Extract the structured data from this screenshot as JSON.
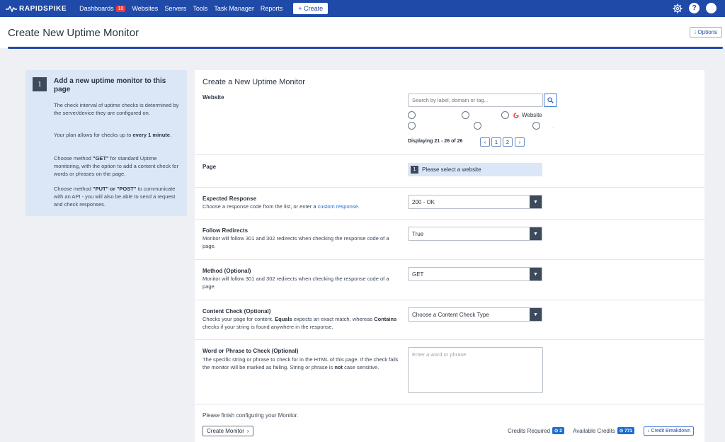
{
  "nav": {
    "brand": "RAPIDSPIKE",
    "items": [
      {
        "label": "Dashboards",
        "badge": "10"
      },
      {
        "label": "Websites"
      },
      {
        "label": "Servers"
      },
      {
        "label": "Tools"
      },
      {
        "label": "Task Manager"
      },
      {
        "label": "Reports"
      }
    ],
    "create_label": "+ Create",
    "help_glyph": "?"
  },
  "header": {
    "title": "Create New Uptime Monitor",
    "options_label": "⁝ Options"
  },
  "info": {
    "number": "1",
    "title": "Add a new uptime monitor to this page",
    "p1": "The check interval of uptime checks is determined by the server/device they are configured on.",
    "p2_pre": "Your plan allows for checks up to ",
    "p2_bold": "every 1 minute",
    "p2_post": ".",
    "p3_pre": "Choose method ",
    "p3_bold": "\"GET\"",
    "p3_post": " for standard Uptime monitoring, with the option to add a content check for words or phrases on the page.",
    "p4_pre": "Choose method ",
    "p4_bold": "\"PUT\" or \"POST\"",
    "p4_post": " to communicate with an API - you will also be able to send a request and check responses."
  },
  "form": {
    "title": "Create a New Uptime Monitor",
    "website": {
      "label": "Website",
      "search_placeholder": "Search by label, domain or tag...",
      "radio_option_label": "Website",
      "pager_text": "Displaying 21 - 26 of 26",
      "pages": [
        "1",
        "2"
      ],
      "prev_glyph": "‹",
      "next_glyph": "›"
    },
    "page": {
      "label": "Page",
      "notice_number": "1",
      "notice": "Please select a website"
    },
    "expected_response": {
      "label": "Expected Response",
      "help_pre": "Choose a response code from the list, or enter a ",
      "help_link": "custom response",
      "help_post": ".",
      "value": "200 - OK"
    },
    "follow_redirects": {
      "label": "Follow Redirects",
      "help": "Monitor will follow 301 and 302 redirects when checking the response code of a page.",
      "value": "True"
    },
    "method": {
      "label": "Method (Optional)",
      "help": "Monitor will follow 301 and 302 redirects when checking the response code of a page.",
      "value": "GET"
    },
    "content_check": {
      "label": "Content Check (Optional)",
      "help_pre": "Checks your page for content. ",
      "help_b1": "Equals",
      "help_mid": " expects an exact match, whereas ",
      "help_b2": "Contains",
      "help_post": " checks if your string is found anywhere in the response.",
      "value": "Choose a Content Check Type"
    },
    "phrase": {
      "label": "Word or Phrase to Check (Optional)",
      "help_pre": "The specific string or phrase to check for in the HTML of this page. If the check fails the monitor will be marked as failing. String or phrase is ",
      "help_bold": "not",
      "help_post": " case sensitive.",
      "placeholder": "Enter a word or phrase"
    },
    "footer": {
      "note": "Please finish configuring your Monitor.",
      "create_label": "Create Monitor",
      "credits_required_label": "Credits Required",
      "credits_required": "2",
      "available_label": "Available Credits",
      "available": "771",
      "breakdown_label": "↓ Credit Breakdown"
    }
  },
  "colors": {
    "nav_bg": "#1f4aa8",
    "info_bg": "#dbe6f6",
    "accent": "#1f6fd1",
    "badge_red": "#e53e3e"
  }
}
